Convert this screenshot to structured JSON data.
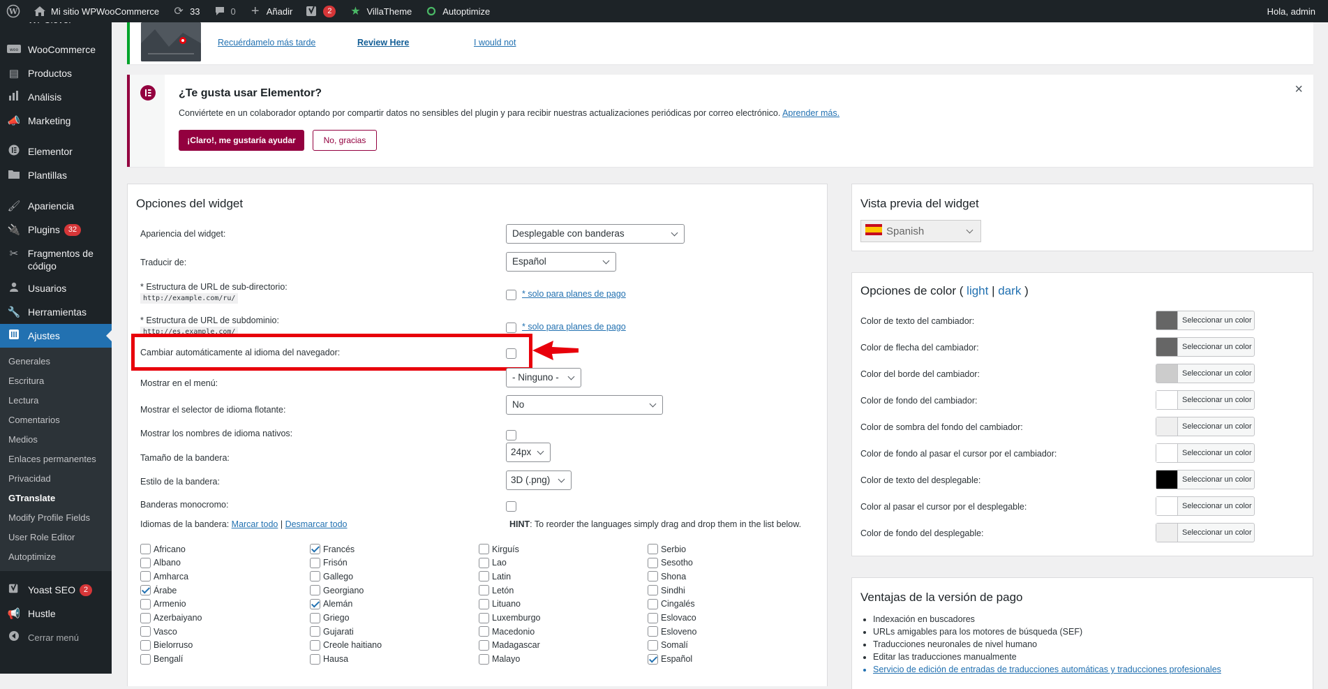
{
  "adminbar": {
    "site_name": "Mi sitio WPWooCommerce",
    "updates_count": "33",
    "comments_count": "0",
    "add_label": "Añadir",
    "yoast_badge": "2",
    "villatheme_label": "VillaTheme",
    "autoptimize_label": "Autoptimize",
    "greeting": "Hola, admin"
  },
  "sidebar": {
    "items": [
      {
        "label": "WPClever",
        "icon": "wpclever-icon"
      },
      {
        "label": "WooCommerce",
        "icon": "woo-icon"
      },
      {
        "label": "Productos",
        "icon": "archive-icon"
      },
      {
        "label": "Análisis",
        "icon": "chart-bar-icon"
      },
      {
        "label": "Marketing",
        "icon": "megaphone-icon"
      },
      {
        "label": "Elementor",
        "icon": "elementor-icon"
      },
      {
        "label": "Plantillas",
        "icon": "folder-icon"
      },
      {
        "label": "Apariencia",
        "icon": "brush-icon"
      },
      {
        "label": "Plugins",
        "icon": "plugin-icon",
        "badge": "32"
      },
      {
        "label": "Fragmentos de código",
        "icon": "scissors-icon"
      },
      {
        "label": "Usuarios",
        "icon": "user-icon"
      },
      {
        "label": "Herramientas",
        "icon": "wrench-icon"
      },
      {
        "label": "Ajustes",
        "icon": "settings-icon"
      }
    ],
    "submenu": [
      "Generales",
      "Escritura",
      "Lectura",
      "Comentarios",
      "Medios",
      "Enlaces permanentes",
      "Privacidad",
      "GTranslate",
      "Modify Profile Fields",
      "User Role Editor",
      "Autoptimize"
    ],
    "bottom": [
      {
        "label": "Yoast SEO",
        "icon": "yoast-icon",
        "badge": "2"
      },
      {
        "label": "Hustle",
        "icon": "hustle-icon"
      },
      {
        "label": "Cerrar menú",
        "icon": "collapse-icon"
      }
    ]
  },
  "review_notice": {
    "remind_later": "Recuérdamelo más tarde",
    "review_here": "Review Here",
    "would_not": "I would not"
  },
  "elementor_notice": {
    "title": "¿Te gusta usar Elementor?",
    "text": "Conviértete en un colaborador optando por compartir datos no sensibles del plugin y para recibir nuestras actualizaciones periódicas por correo electrónico.",
    "learn_more": "Aprender más.",
    "yes_button": "¡Claro!, me gustaría ayudar",
    "no_button": "No, gracias",
    "close": "×"
  },
  "widget_options": {
    "title": "Opciones del widget",
    "rows": {
      "appearance_label": "Apariencia del widget:",
      "appearance_value": "Desplegable con banderas",
      "translate_from_label": "Traducir de:",
      "translate_from_value": "Español",
      "subdir_label": "* Estructura de URL de sub-directorio:",
      "subdir_example": "http://example.com/ru/",
      "subdomain_label": "* Estructura de URL de subdominio:",
      "subdomain_example": "http://es.example.com/",
      "paid_only": "* solo para planes de pago",
      "auto_switch_label": "Cambiar automáticamente al idioma del navegador:",
      "show_in_menu_label": "Mostrar en el menú:",
      "show_in_menu_value": "- Ninguno -",
      "floating_label": "Mostrar el selector de idioma flotante:",
      "floating_value": "No",
      "native_names_label": "Mostrar los nombres de idioma nativos:",
      "flag_size_label": "Tamaño de la bandera:",
      "flag_size_value": "24px",
      "flag_style_label": "Estilo de la bandera:",
      "flag_style_value": "3D (.png)",
      "mono_flags_label": "Banderas monocromo:",
      "flag_languages_label": "Idiomas de la bandera:",
      "select_all": "Marcar todo",
      "separator": "|",
      "deselect_all": "Desmarcar todo",
      "hint_bold": "HINT",
      "hint_text": ": To reorder the languages simply drag and drop them in the list below."
    },
    "languages": [
      [
        {
          "n": "Africano",
          "c": false
        },
        {
          "n": "Albano",
          "c": false
        },
        {
          "n": "Amharca",
          "c": false
        },
        {
          "n": "Árabe",
          "c": true
        },
        {
          "n": "Armenio",
          "c": false
        },
        {
          "n": "Azerbaiyano",
          "c": false
        },
        {
          "n": "Vasco",
          "c": false
        },
        {
          "n": "Bielorruso",
          "c": false
        },
        {
          "n": "Bengalí",
          "c": false
        }
      ],
      [
        {
          "n": "Francés",
          "c": true
        },
        {
          "n": "Frisón",
          "c": false
        },
        {
          "n": "Gallego",
          "c": false
        },
        {
          "n": "Georgiano",
          "c": false
        },
        {
          "n": "Alemán",
          "c": true
        },
        {
          "n": "Griego",
          "c": false
        },
        {
          "n": "Gujarati",
          "c": false
        },
        {
          "n": "Creole haitiano",
          "c": false
        },
        {
          "n": "Hausa",
          "c": false
        }
      ],
      [
        {
          "n": "Kirguís",
          "c": false
        },
        {
          "n": "Lao",
          "c": false
        },
        {
          "n": "Latin",
          "c": false
        },
        {
          "n": "Letón",
          "c": false
        },
        {
          "n": "Lituano",
          "c": false
        },
        {
          "n": "Luxemburgo",
          "c": false
        },
        {
          "n": "Macedonio",
          "c": false
        },
        {
          "n": "Madagascar",
          "c": false
        },
        {
          "n": "Malayo",
          "c": false
        }
      ],
      [
        {
          "n": "Serbio",
          "c": false
        },
        {
          "n": "Sesotho",
          "c": false
        },
        {
          "n": "Shona",
          "c": false
        },
        {
          "n": "Sindhi",
          "c": false
        },
        {
          "n": "Cingalés",
          "c": false
        },
        {
          "n": "Eslovaco",
          "c": false
        },
        {
          "n": "Esloveno",
          "c": false
        },
        {
          "n": "Somalí",
          "c": false
        },
        {
          "n": "Español",
          "c": true
        }
      ]
    ]
  },
  "preview": {
    "title": "Vista previa del widget",
    "selected_language": "Spanish"
  },
  "color_options": {
    "title": "Opciones de color",
    "open_paren": "(",
    "light": "light",
    "sep": "|",
    "dark": "dark",
    "close_paren": ")",
    "button_label": "Seleccionar un color",
    "rows": [
      {
        "label": "Color de texto del cambiador:",
        "color": "#666666"
      },
      {
        "label": "Color de flecha del cambiador:",
        "color": "#666666"
      },
      {
        "label": "Color del borde del cambiador:",
        "color": "#cccccc"
      },
      {
        "label": "Color de fondo del cambiador:",
        "color": "#ffffff"
      },
      {
        "label": "Color de sombra del fondo del cambiador:",
        "color": "#efefef"
      },
      {
        "label": "Color de fondo al pasar el cursor por el cambiador:",
        "color": "#ffffff"
      },
      {
        "label": "Color de texto del desplegable:",
        "color": "#000000"
      },
      {
        "label": "Color al pasar el cursor por el desplegable:",
        "color": "#ffffff"
      },
      {
        "label": "Color de fondo del desplegable:",
        "color": "#eeeeee"
      }
    ]
  },
  "paid_version": {
    "title": "Ventajas de la versión de pago",
    "items": [
      "Indexación en buscadores",
      "URLs amigables para los motores de búsqueda (SEF)",
      "Traducciones neuronales de nivel humano",
      "Editar las traducciones manualmente",
      "Servicio de edición de entradas de traducciones automáticas y traducciones profesionales"
    ]
  },
  "colors": {
    "accent": "#2271b1",
    "elementor": "#93003f",
    "highlight": "#e8000b",
    "admin_dark": "#1d2327"
  }
}
